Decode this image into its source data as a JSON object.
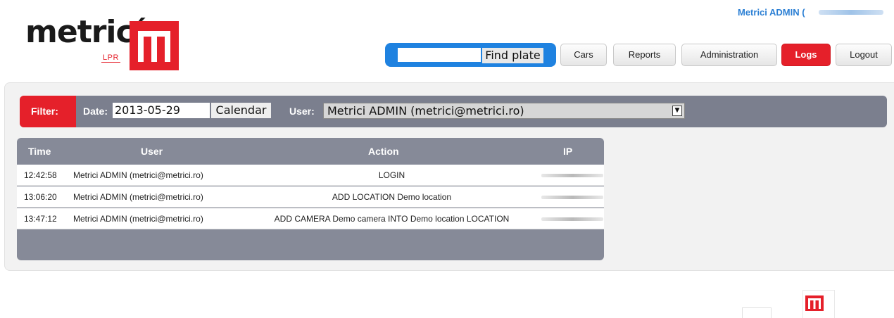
{
  "brand": {
    "logo_text": "metricí",
    "logo_sub": "LPR",
    "accent_color": "#e5202a",
    "link_color": "#2b7fd4",
    "search_color": "#1f82e0"
  },
  "header": {
    "user_label": "Metrici ADMIN (",
    "find_plate_label": "Find plate",
    "nav": [
      "Cars",
      "Reports",
      "Administration",
      "Logs",
      "Logout"
    ],
    "active_nav": "Logs"
  },
  "filter": {
    "label": "Filter:",
    "date_label": "Date:",
    "date_value": "2013-05-29",
    "calendar_label": "Calendar",
    "user_label": "User:",
    "user_value": "Metrici ADMIN (metrici@metrici.ro)"
  },
  "log_table": {
    "columns": [
      "Time",
      "User",
      "Action",
      "IP"
    ],
    "rows": [
      {
        "time": "12:42:58",
        "user": "Metrici ADMIN (metrici@metrici.ro)",
        "action": "LOGIN"
      },
      {
        "time": "13:06:20",
        "user": "Metrici ADMIN (metrici@metrici.ro)",
        "action": "ADD LOCATION Demo location"
      },
      {
        "time": "13:47:12",
        "user": "Metrici ADMIN (metrici@metrici.ro)",
        "action": "ADD CAMERA Demo camera INTO Demo location LOCATION"
      }
    ]
  }
}
